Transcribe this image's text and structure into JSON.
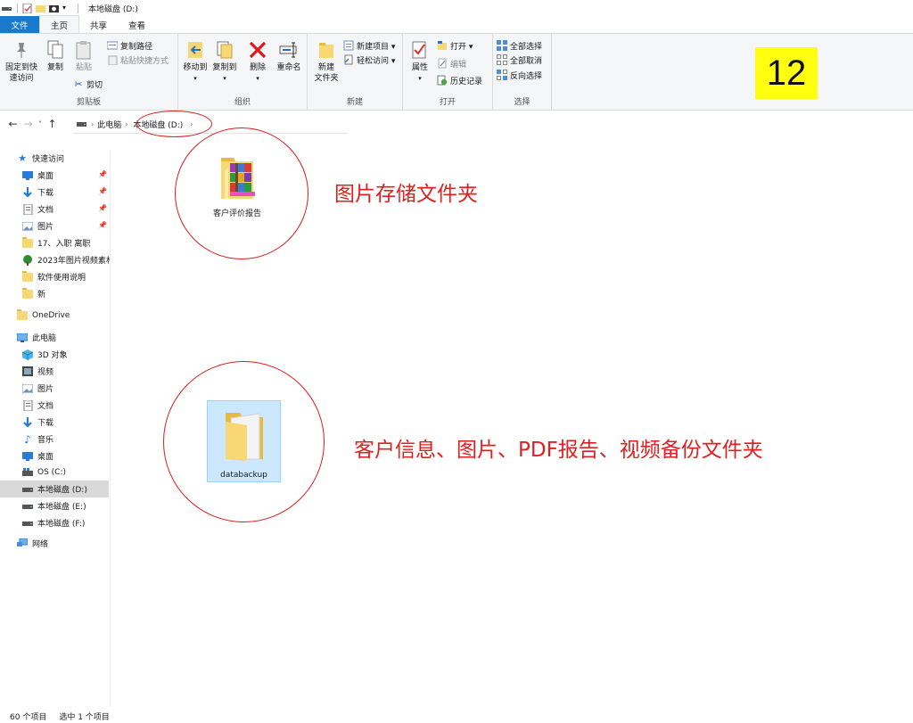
{
  "window": {
    "title": "本地磁盘 (D:)"
  },
  "tabs": [
    {
      "label": "文件"
    },
    {
      "label": "主页"
    },
    {
      "label": "共享"
    },
    {
      "label": "查看"
    }
  ],
  "ribbon": {
    "clipboard": {
      "pin_label_1": "固定到快",
      "pin_label_2": "速访问",
      "copy_label": "复制",
      "paste_label": "粘贴",
      "copy_path_label": "复制路径",
      "paste_shortcut_label": "粘贴快捷方式",
      "cut_label": "剪切",
      "group_label": "剪贴板"
    },
    "organize": {
      "move_to_label": "移动到",
      "copy_to_label": "复制到",
      "delete_label": "删除",
      "rename_label": "重命名",
      "group_label": "组织"
    },
    "new": {
      "new_folder_label_1": "新建",
      "new_folder_label_2": "文件夹",
      "new_item_label": "新建项目 ▾",
      "easy_access_label": "轻松访问 ▾",
      "group_label": "新建"
    },
    "open": {
      "properties_label": "属性",
      "open_label": "打开 ▾",
      "edit_label": "编辑",
      "history_label": "历史记录",
      "group_label": "打开"
    },
    "select": {
      "select_all_label": "全部选择",
      "select_none_label": "全部取消",
      "invert_label": "反向选择",
      "group_label": "选择"
    }
  },
  "badge": {
    "text": "12",
    "color": "#ffff10"
  },
  "address": {
    "crumbs": [
      "此电脑",
      "本地磁盘 (D:)"
    ]
  },
  "sidebar": {
    "quick_access": "快速访问",
    "quick_items": [
      {
        "label": "桌面",
        "icon": "desktop-icon",
        "pinned": true
      },
      {
        "label": "下载",
        "icon": "download-icon",
        "pinned": true
      },
      {
        "label": "文档",
        "icon": "document-icon",
        "pinned": true
      },
      {
        "label": "图片",
        "icon": "picture-icon",
        "pinned": true
      },
      {
        "label": "17、入职 离职",
        "icon": "folder-icon",
        "pinned": false
      },
      {
        "label": "2023年图片视频素材",
        "icon": "tree-icon",
        "pinned": false
      },
      {
        "label": "软件使用说明",
        "icon": "folder-icon",
        "pinned": false
      },
      {
        "label": "新",
        "icon": "folder-icon",
        "pinned": false
      }
    ],
    "onedrive": "OneDrive",
    "this_pc": "此电脑",
    "pc_items": [
      {
        "label": "3D 对象",
        "icon": "cube-icon"
      },
      {
        "label": "视频",
        "icon": "video-icon"
      },
      {
        "label": "图片",
        "icon": "picture-icon"
      },
      {
        "label": "文档",
        "icon": "document-icon"
      },
      {
        "label": "下载",
        "icon": "download-icon"
      },
      {
        "label": "音乐",
        "icon": "music-icon"
      },
      {
        "label": "桌面",
        "icon": "desktop-icon"
      },
      {
        "label": "OS (C:)",
        "icon": "windows-drive-icon"
      },
      {
        "label": "本地磁盘 (D:)",
        "icon": "drive-icon",
        "selected": true
      },
      {
        "label": "本地磁盘 (E:)",
        "icon": "drive-icon"
      },
      {
        "label": "本地磁盘 (F:)",
        "icon": "drive-icon"
      }
    ],
    "network": "网络"
  },
  "files": [
    {
      "name": "客户评价报告",
      "icon": "winrar-folder-icon"
    },
    {
      "name": "databackup",
      "icon": "folder-icon",
      "selected": true
    }
  ],
  "annotations": {
    "first": "图片存储文件夹",
    "second": "客户信息、图片、PDF报告、视频备份文件夹",
    "color": "#e02020"
  },
  "status": {
    "count": "60 个项目",
    "selected": "选中 1 个项目"
  }
}
